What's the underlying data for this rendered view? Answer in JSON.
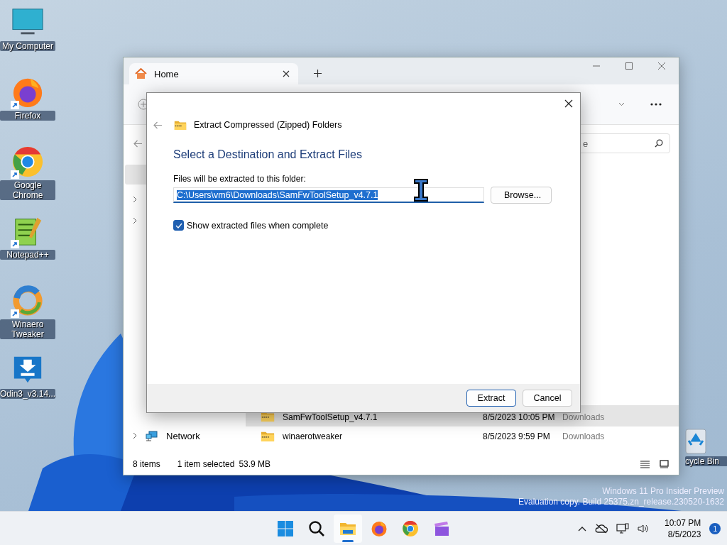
{
  "desktop_icons": [
    {
      "label": "My Computer",
      "kind": "monitor"
    },
    {
      "label": "Firefox",
      "kind": "firefox",
      "shortcut": true
    },
    {
      "label": "Google Chrome",
      "kind": "chrome",
      "shortcut": true
    },
    {
      "label": "Notepad++",
      "kind": "notepad",
      "shortcut": true
    },
    {
      "label": "Winaero Tweaker",
      "kind": "winaero",
      "shortcut": true
    },
    {
      "label": "Odin3_v3.14...",
      "kind": "download"
    }
  ],
  "recycle_bin": {
    "label": "cycle Bin"
  },
  "explorer": {
    "tabs": [
      {
        "label": "Home",
        "selected": true
      }
    ],
    "search": {
      "placeholder": "e"
    },
    "nav": [
      {
        "kind": "chevron"
      },
      {
        "kind": "chevron"
      },
      {
        "kind": "network",
        "label": "Network"
      }
    ],
    "files": [
      {
        "name": "SamFwToolSetup_v4.7.1",
        "date": "8/5/2023 10:05 PM",
        "location": "Downloads",
        "selected": true
      },
      {
        "name": "winaerotweaker",
        "date": "8/5/2023 9:59 PM",
        "location": "Downloads",
        "selected": false
      }
    ],
    "status": {
      "count": "8 items",
      "selection": "1 item selected",
      "size": "53.9 MB"
    }
  },
  "dialog": {
    "title": "Extract Compressed (Zipped) Folders",
    "heading": "Select a Destination and Extract Files",
    "field_label": "Files will be extracted to this folder:",
    "path": {
      "value": "C:\\Users\\vm6\\Downloads\\SamFwToolSetup_v4.7.1",
      "selected": true
    },
    "browse": "Browse...",
    "show_files": {
      "label": "Show extracted files when complete",
      "checked": true
    },
    "buttons": [
      {
        "label": "Extract",
        "default": true
      },
      {
        "label": "Cancel",
        "default": false
      }
    ]
  },
  "watermark": [
    "Windows 11 Pro Insider Preview",
    "Evaluation copy. Build 25375.zn_release.230520-1632"
  ],
  "taskbar": {
    "apps": [
      {
        "kind": "start",
        "active": false
      },
      {
        "kind": "search",
        "active": false
      },
      {
        "kind": "explorer",
        "active": true
      },
      {
        "kind": "firefox",
        "active": false
      },
      {
        "kind": "chrome",
        "active": false
      },
      {
        "kind": "clapper",
        "active": false
      }
    ],
    "time": "10:07 PM",
    "date": "8/5/2023",
    "notifications": "1"
  }
}
